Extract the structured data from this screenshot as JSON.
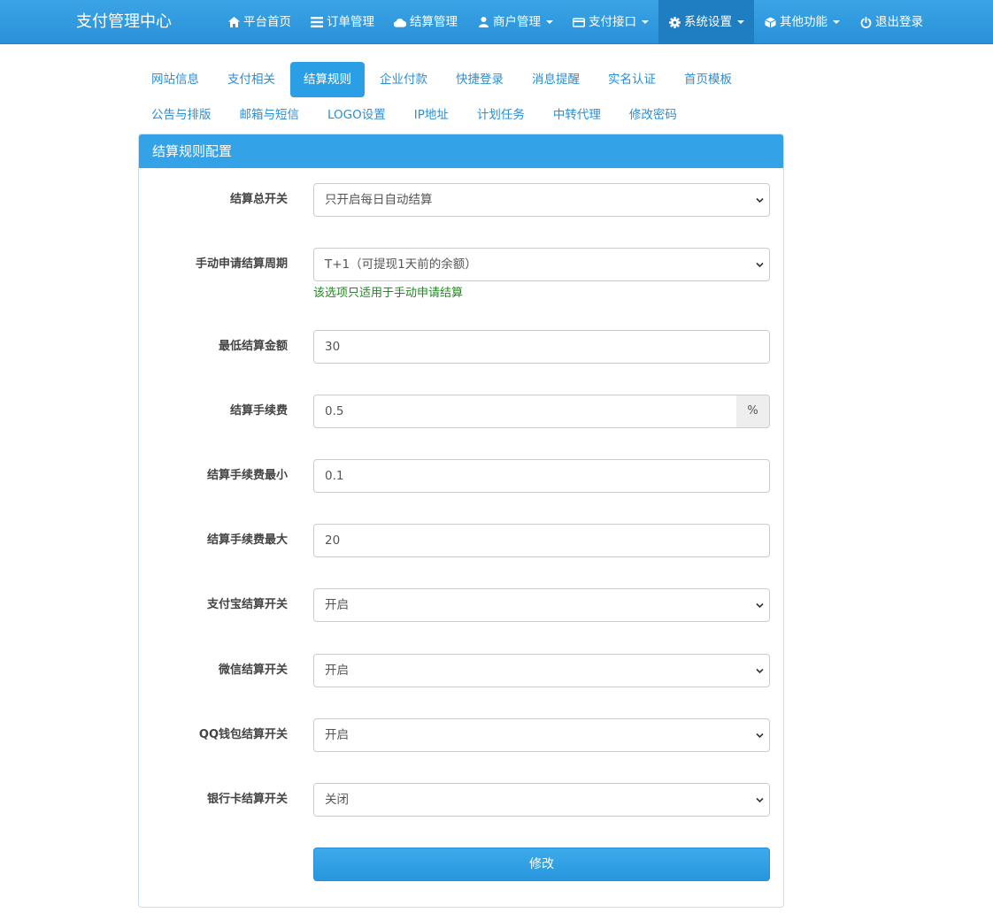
{
  "navbar": {
    "brand": "支付管理中心",
    "items": [
      {
        "label": "平台首页",
        "icon": "home-icon",
        "dropdown": false,
        "active": false
      },
      {
        "label": "订单管理",
        "icon": "list-icon",
        "dropdown": false,
        "active": false
      },
      {
        "label": "结算管理",
        "icon": "cloud-icon",
        "dropdown": false,
        "active": false
      },
      {
        "label": "商户管理",
        "icon": "user-icon",
        "dropdown": true,
        "active": false
      },
      {
        "label": "支付接口",
        "icon": "credit-card-icon",
        "dropdown": true,
        "active": false
      },
      {
        "label": "系统设置",
        "icon": "gear-icon",
        "dropdown": true,
        "active": true
      },
      {
        "label": "其他功能",
        "icon": "cube-icon",
        "dropdown": true,
        "active": false
      },
      {
        "label": "退出登录",
        "icon": "power-icon",
        "dropdown": false,
        "active": false
      }
    ]
  },
  "tabs": {
    "row1": [
      "网站信息",
      "支付相关",
      "结算规则",
      "企业付款",
      "快捷登录",
      "消息提醒",
      "实名认证",
      "首页模板"
    ],
    "row2": [
      "公告与排版",
      "邮箱与短信",
      "LOGO设置",
      "IP地址",
      "计划任务",
      "中转代理",
      "修改密码"
    ],
    "active": "结算规则"
  },
  "panel": {
    "title": "结算规则配置",
    "fields": [
      {
        "label": "结算总开关",
        "type": "select",
        "value": "只开启每日自动结算"
      },
      {
        "label": "手动申请结算周期",
        "type": "select",
        "value": "T+1（可提现1天前的余额）",
        "help": "该选项只适用于手动申请结算"
      },
      {
        "label": "最低结算金额",
        "type": "input",
        "value": "30"
      },
      {
        "label": "结算手续费",
        "type": "input",
        "value": "0.5",
        "addon": "%"
      },
      {
        "label": "结算手续费最小",
        "type": "input",
        "value": "0.1"
      },
      {
        "label": "结算手续费最大",
        "type": "input",
        "value": "20"
      },
      {
        "label": "支付宝结算开关",
        "type": "select",
        "value": "开启"
      },
      {
        "label": "微信结算开关",
        "type": "select",
        "value": "开启"
      },
      {
        "label": "QQ钱包结算开关",
        "type": "select",
        "value": "开启"
      },
      {
        "label": "银行卡结算开关",
        "type": "select",
        "value": "关闭"
      }
    ],
    "submit_label": "修改"
  },
  "colors": {
    "navbar": "#2a91d8",
    "accent": "#2a9fe6",
    "help_text": "#1e8a1e"
  }
}
